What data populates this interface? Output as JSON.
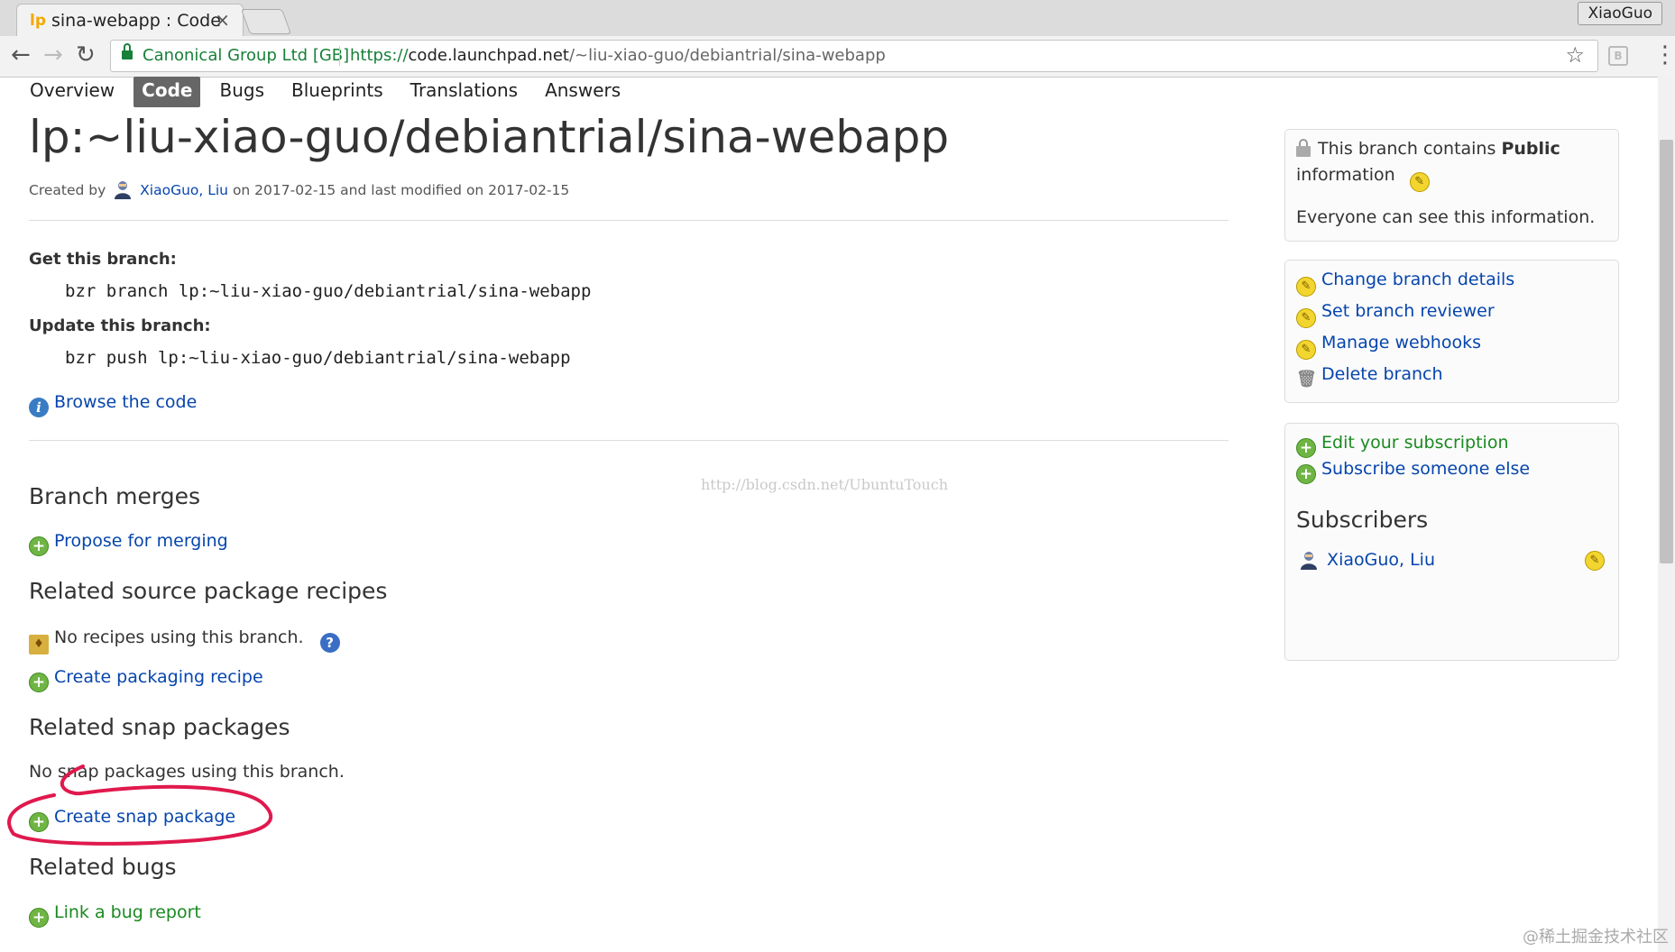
{
  "browser": {
    "tab_favicon": "lp",
    "tab_title": "sina-webapp : Code",
    "tab_close": "×",
    "profile_name": "XiaoGuo",
    "security_label": "Canonical Group Ltd [GB]",
    "url_scheme": "https://",
    "url_host": "code.launchpad.net",
    "url_path": "/~liu-xiao-guo/debiantrial/sina-webapp",
    "back": "←",
    "forward": "→",
    "reload": "↻",
    "star": "☆",
    "menu": "⋮",
    "extension_label": "B"
  },
  "nav": {
    "tabs": [
      "Overview",
      "Code",
      "Bugs",
      "Blueprints",
      "Translations",
      "Answers"
    ],
    "active": "Code"
  },
  "branch": {
    "title": "lp:~liu-xiao-guo/debiantrial/sina-webapp",
    "created_prefix": "Created by",
    "owner": "XiaoGuo, Liu",
    "created_suffix": "on 2017-02-15 and last modified on 2017-02-15",
    "get_label": "Get this branch:",
    "get_cmd": "bzr branch lp:~liu-xiao-guo/debiantrial/sina-webapp",
    "update_label": "Update this branch:",
    "update_cmd": "bzr push lp:~liu-xiao-guo/debiantrial/sina-webapp",
    "browse": "Browse the code"
  },
  "sections": {
    "merges_title": "Branch merges",
    "propose": "Propose for merging",
    "recipes_title": "Related source package recipes",
    "no_recipes": "No recipes using this branch.",
    "create_recipe": "Create packaging recipe",
    "snaps_title": "Related snap packages",
    "no_snaps": "No snap packages using this branch.",
    "create_snap": "Create snap package",
    "bugs_title": "Related bugs",
    "link_bug": "Link a bug report"
  },
  "sidebar": {
    "privacy_prefix": "This branch contains",
    "privacy_level": "Public",
    "privacy_suffix": "information",
    "privacy_desc": "Everyone can see this information.",
    "actions": [
      "Change branch details",
      "Set branch reviewer",
      "Manage webhooks",
      "Delete branch"
    ],
    "edit_subscription": "Edit your subscription",
    "subscribe_else": "Subscribe someone else",
    "subscribers_title": "Subscribers",
    "subscriber": "XiaoGuo, Liu"
  },
  "watermark": "http://blog.csdn.net/UbuntuTouch",
  "footer_watermark": "@稀土掘金技术社区",
  "colors": {
    "link": "#0645ad",
    "green_link": "#1a8a20",
    "annotation": "#e0194d",
    "active_tab": "#666666"
  }
}
